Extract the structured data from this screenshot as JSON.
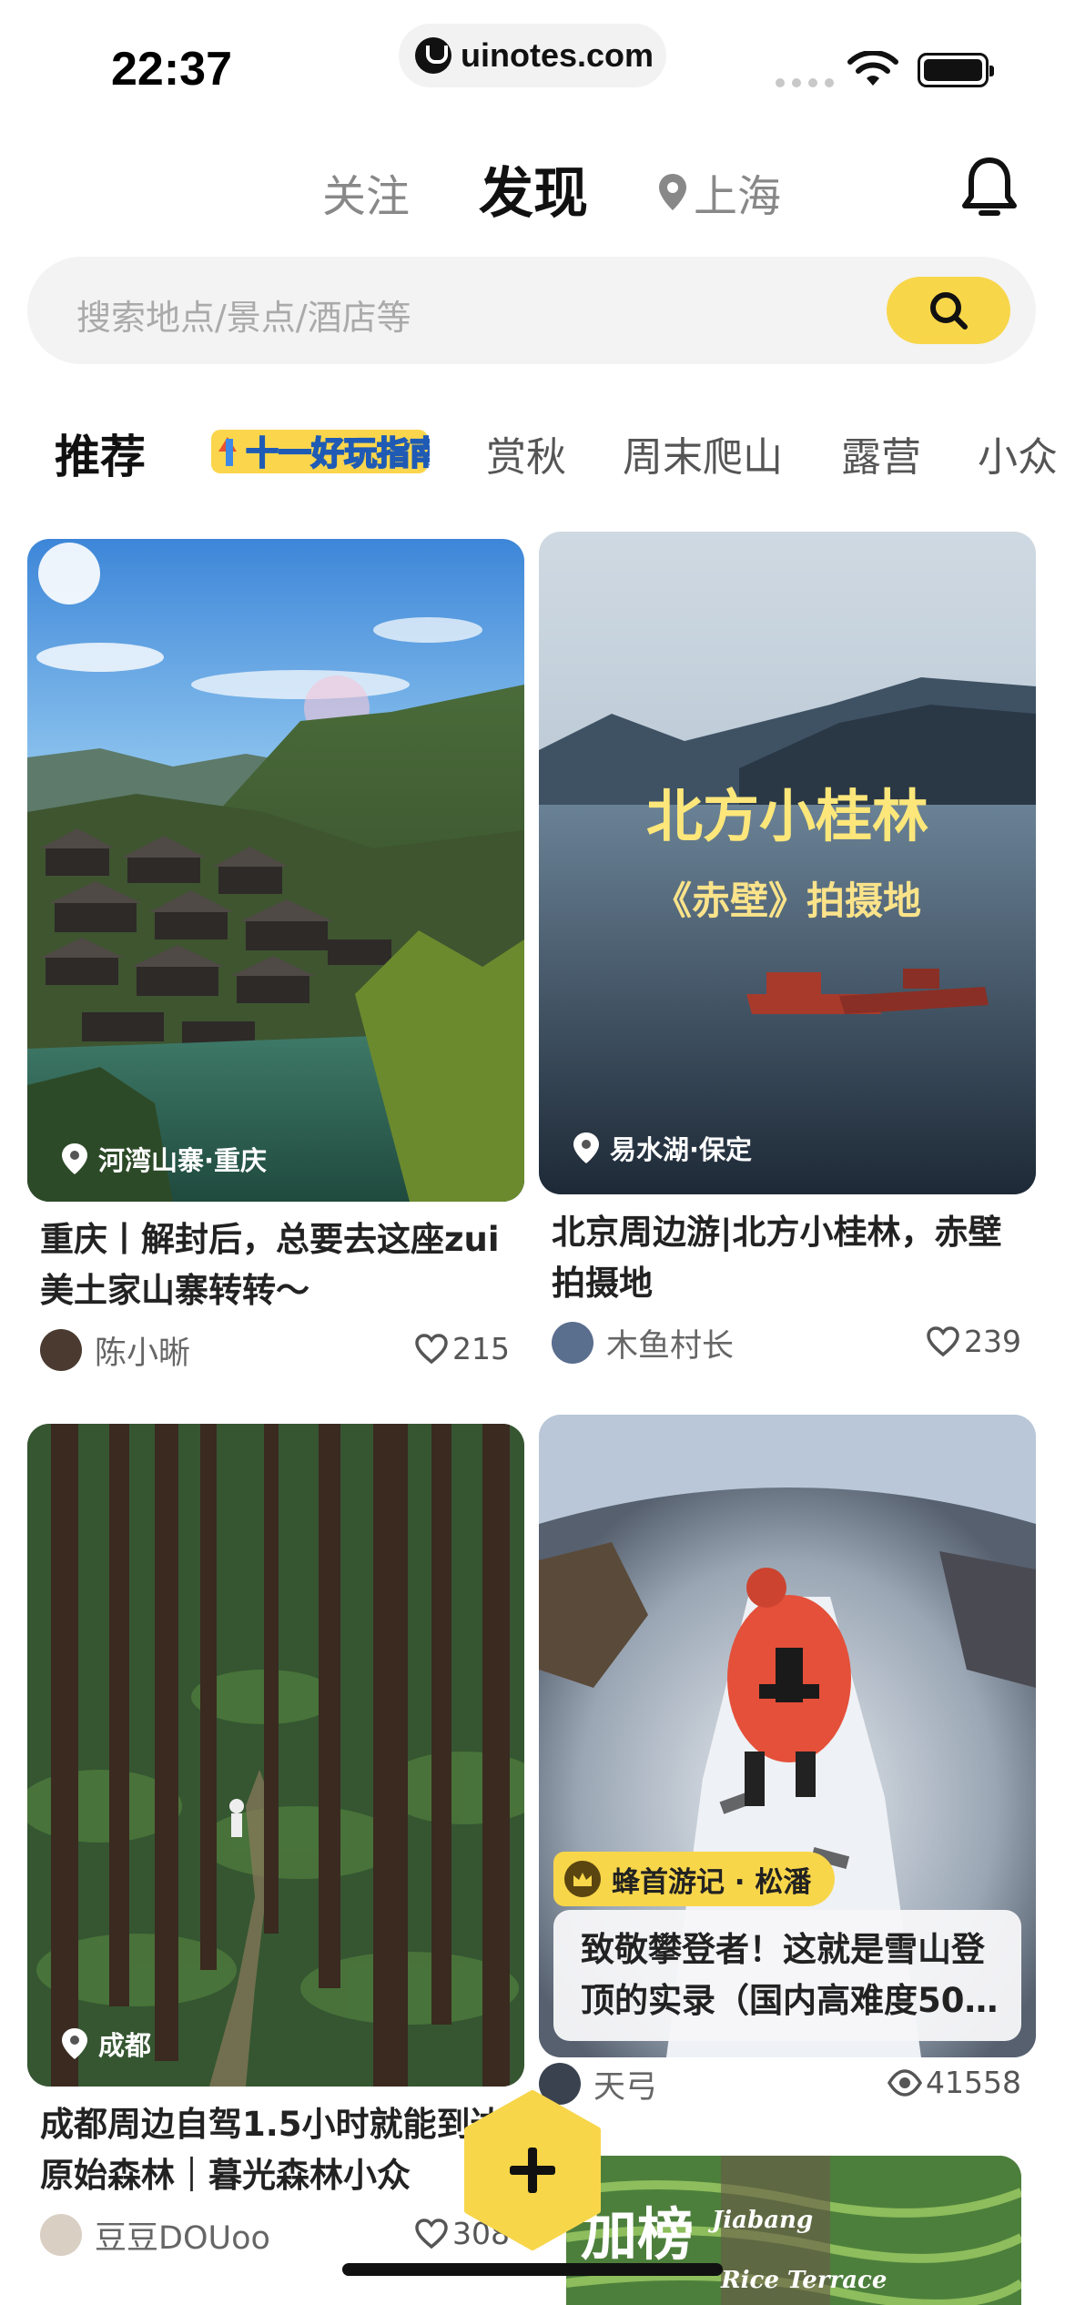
{
  "status_bar": {
    "time": "22:37",
    "url": "uinotes.com"
  },
  "top_nav": {
    "follow": "关注",
    "discover": "发现",
    "city": "上海",
    "bell_icon": "bell-icon"
  },
  "search": {
    "placeholder": "搜索地点/景点/酒店等",
    "icon": "search-icon"
  },
  "categories": {
    "active": "推荐",
    "banner": "十一好玩指南",
    "items": [
      "赏秋",
      "周末爬山",
      "露营",
      "小众"
    ]
  },
  "cards": [
    {
      "location": "河湾山寨·重庆",
      "title": "重庆丨解封后，总要去这座zui美土家山寨转转～",
      "author": "陈小晰",
      "likes": "215"
    },
    {
      "location": "易水湖·保定",
      "image_text_1": "北方小桂林",
      "image_text_2": "《赤壁》拍摄地",
      "title": "北京周边游|北方小桂林，赤壁拍摄地",
      "author": "木鱼村长",
      "likes": "239"
    },
    {
      "location": "成都",
      "title": "成都周边自驾1.5小时就能到达原始森林｜暮光森林小众",
      "author": "豆豆DOUoo",
      "likes": "308"
    },
    {
      "badge": "蜂首游记 · 松潘",
      "title": "致敬攀登者！这就是雪山登顶的实录（国内高难度50…",
      "author": "天弓",
      "views": "41558"
    },
    {
      "image_text_1": "加榜",
      "image_text_2": "Jiabang",
      "image_text_3": "Rice Terrace"
    }
  ],
  "colors": {
    "accent": "#f8d64a",
    "text": "#222222",
    "muted": "#888888"
  }
}
